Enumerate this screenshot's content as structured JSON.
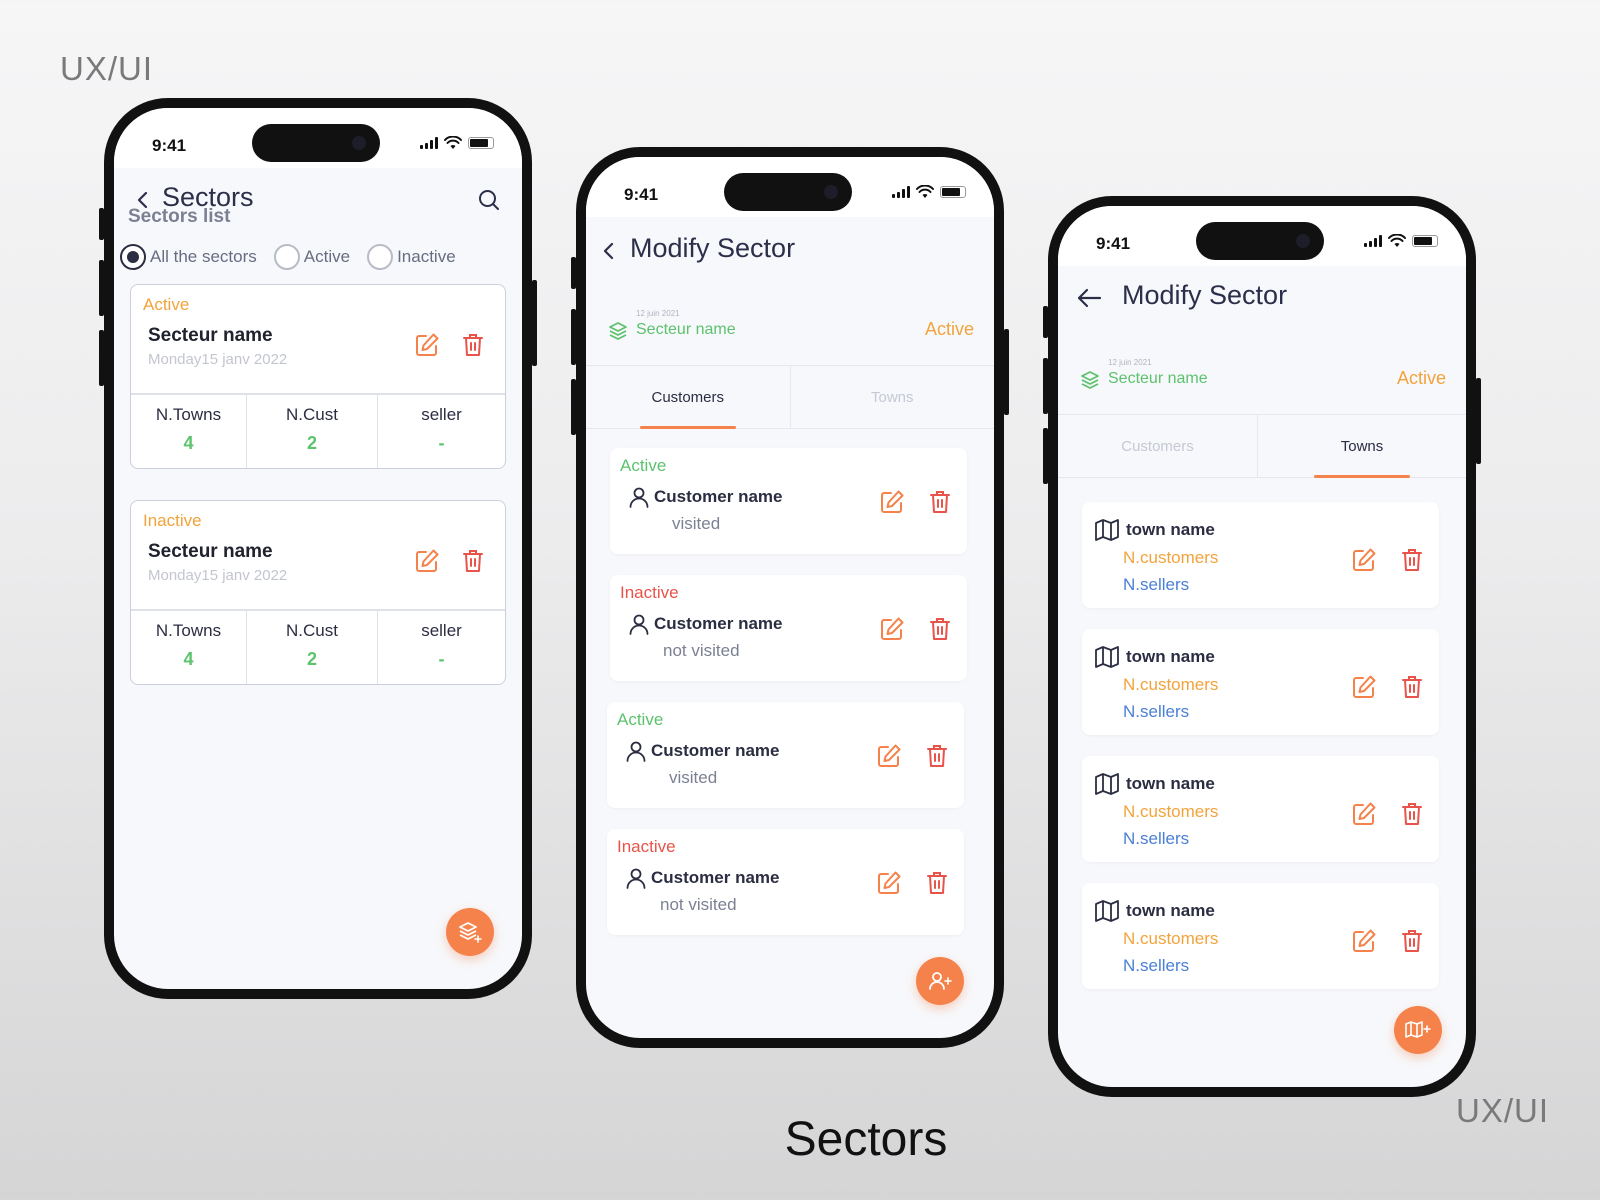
{
  "page": {
    "corner_label_top": "UX/UI",
    "corner_label_bottom": "UX/UI",
    "footer_title": "Sectors"
  },
  "colors": {
    "accent": "#f5824a",
    "active_green": "#5cc26e",
    "inactive_red": "#e8534a",
    "warning_orange": "#f3a33b",
    "link_blue": "#4a7fd6",
    "title_navy": "#2c2f4a"
  },
  "status_bar": {
    "time": "9:41"
  },
  "screen1": {
    "title": "Sectors",
    "section_title": "Sectors list",
    "filters": [
      {
        "label": "All the sectors",
        "selected": true
      },
      {
        "label": "Active",
        "selected": false
      },
      {
        "label": "Inactive",
        "selected": false
      }
    ],
    "cards": [
      {
        "status": "Active",
        "name": "Secteur name",
        "date": "Monday15 janv 2022",
        "stats": [
          {
            "label": "N.Towns",
            "value": "4"
          },
          {
            "label": "N.Cust",
            "value": "2"
          },
          {
            "label": "seller",
            "value": "-"
          }
        ]
      },
      {
        "status": "Inactive",
        "name": "Secteur name",
        "date": "Monday15 janv 2022",
        "stats": [
          {
            "label": "N.Towns",
            "value": "4"
          },
          {
            "label": "N.Cust",
            "value": "2"
          },
          {
            "label": "seller",
            "value": "-"
          }
        ]
      }
    ],
    "fab_icon": "add-layers-icon"
  },
  "screen2": {
    "title": "Modify Sector",
    "sector": {
      "date": "12 juin 2021",
      "name": "Secteur name",
      "status": "Active"
    },
    "tabs": [
      {
        "label": "Customers",
        "active": true
      },
      {
        "label": "Towns",
        "active": false
      }
    ],
    "customers": [
      {
        "status": "Active",
        "name": "Customer name",
        "visit": "visited"
      },
      {
        "status": "Inactive",
        "name": "Customer name",
        "visit": "not visited"
      },
      {
        "status": "Active",
        "name": "Customer name",
        "visit": "visited"
      },
      {
        "status": "Inactive",
        "name": "Customer name",
        "visit": "not visited"
      }
    ],
    "fab_icon": "add-user-icon"
  },
  "screen3": {
    "title": "Modify Sector",
    "sector": {
      "date": "12 juin 2021",
      "name": "Secteur name",
      "status": "Active"
    },
    "tabs": [
      {
        "label": "Customers",
        "active": false
      },
      {
        "label": "Towns",
        "active": true
      }
    ],
    "towns": [
      {
        "name": "town name",
        "customers": "N.customers",
        "sellers": "N.sellers"
      },
      {
        "name": "town name",
        "customers": "N.customers",
        "sellers": "N.sellers"
      },
      {
        "name": "town name",
        "customers": "N.customers",
        "sellers": "N.sellers"
      },
      {
        "name": "town name",
        "customers": "N.customers",
        "sellers": "N.sellers"
      }
    ],
    "fab_icon": "add-map-icon"
  }
}
